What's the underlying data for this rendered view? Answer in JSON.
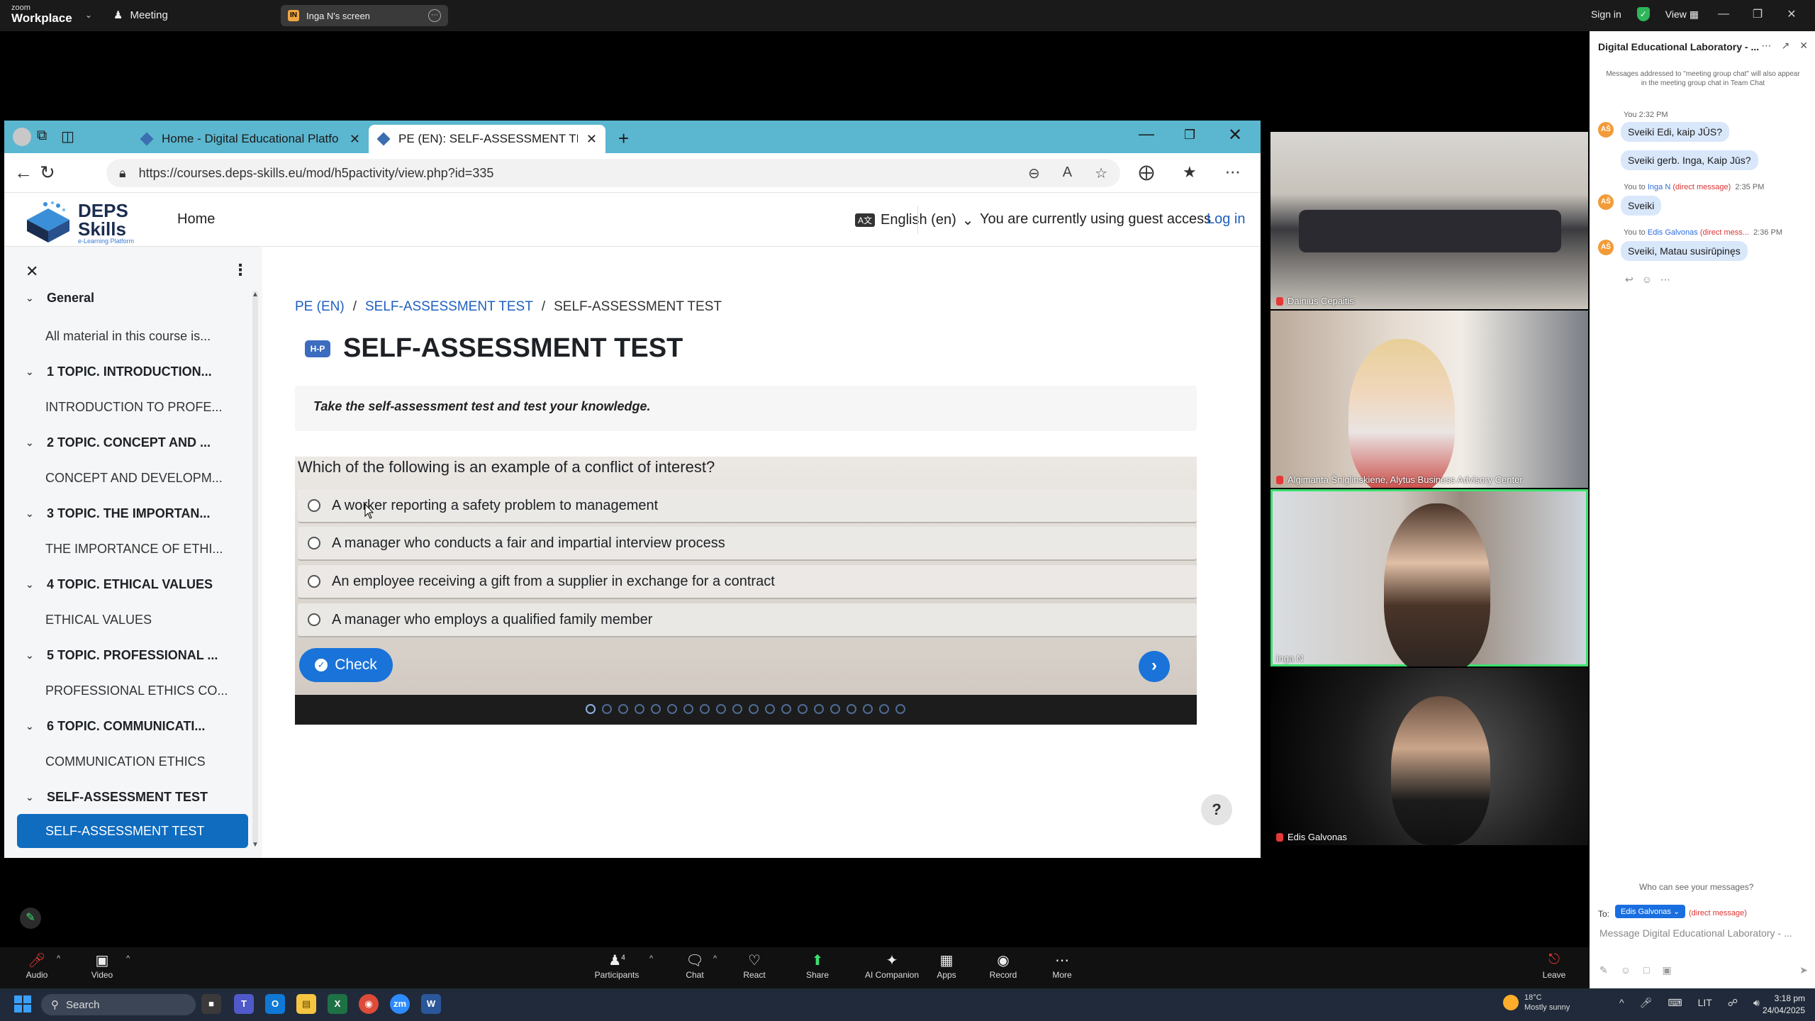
{
  "zoom": {
    "logo_small": "zoom",
    "logo_big": "Workplace",
    "meeting_label": "Meeting",
    "share_badge": "IN",
    "share_label": "Inga N's screen",
    "sign_in": "Sign in",
    "view": "View"
  },
  "browser": {
    "tabs": [
      {
        "label": "Home - Digital Educational Platfo"
      },
      {
        "label": "PE (EN): SELF-ASSESSMENT TEST"
      }
    ],
    "url": "https://courses.deps-skills.eu/mod/h5pactivity/view.php?id=335"
  },
  "site": {
    "logo_line1": "DEPS",
    "logo_line2": "Skills",
    "logo_tag": "e-Learning Platform",
    "nav_home": "Home",
    "language": "English (en)",
    "guest_notice": "You are currently using guest access",
    "login": "Log in"
  },
  "sidebar": {
    "sections": [
      {
        "title": "General",
        "item": "All material in this course is..."
      },
      {
        "title": "1 TOPIC. INTRODUCTION...",
        "item": "INTRODUCTION TO PROFE..."
      },
      {
        "title": "2 TOPIC. CONCEPT AND ...",
        "item": "CONCEPT AND DEVELOPM..."
      },
      {
        "title": "3 TOPIC. THE IMPORTAN...",
        "item": "THE IMPORTANCE OF ETHI..."
      },
      {
        "title": "4 TOPIC. ETHICAL VALUES",
        "item": "ETHICAL VALUES"
      },
      {
        "title": "5 TOPIC. PROFESSIONAL ...",
        "item": "PROFESSIONAL ETHICS CO..."
      },
      {
        "title": "6 TOPIC. COMMUNICATI...",
        "item": "COMMUNICATION ETHICS"
      },
      {
        "title": "SELF-ASSESSMENT TEST",
        "item": "SELF-ASSESSMENT TEST"
      }
    ]
  },
  "main": {
    "breadcrumb": [
      "PE (EN)",
      "SELF-ASSESSMENT TEST",
      "SELF-ASSESSMENT TEST"
    ],
    "h5p_badge": "H-P",
    "title": "SELF-ASSESSMENT TEST",
    "intro": "Take the self-assessment test and test your knowledge.",
    "question": "Which of the following is an example of a conflict of interest?",
    "answers": [
      "A worker reporting a safety problem to management",
      "A manager who conducts a fair and impartial interview process",
      "An employee receiving a gift from a supplier in exchange for a contract",
      "A manager who employs a qualified family member"
    ],
    "check_label": "Check",
    "help": "?"
  },
  "gallery": [
    {
      "name": "Dainius Cepaitis"
    },
    {
      "name": "Algimanta Šniglinskienė, Alytus Business Advisory Center"
    },
    {
      "name": "Inga N"
    },
    {
      "name": "Edis Galvonas"
    }
  ],
  "chat": {
    "title": "Digital Educational Laboratory - ...",
    "notice": "Messages addressed to \"meeting group chat\" will also appear in the meeting group chat in Team Chat",
    "avatar": "AŠ",
    "messages": [
      {
        "meta_you": "You",
        "time": "2:32 PM",
        "text": "Sveiki Edi, kaip JŪS?"
      },
      {
        "text": "Sveiki gerb. Inga, Kaip Jūs?"
      },
      {
        "meta_you": "You to",
        "to": "Inga N",
        "dm": "(direct message)",
        "time": "2:35 PM",
        "text": "Sveiki"
      },
      {
        "meta_you": "You to",
        "to": "Edis Galvonas",
        "dm": "(direct mess...",
        "time": "2:36 PM",
        "text": "Sveiki, Matau susirūpinęs"
      }
    ],
    "who_can_see": "Who can see your messages?",
    "to_label": "To:",
    "to_recipient": "Edis Galvonas",
    "to_dm": "(direct message)",
    "input_placeholder": "Message Digital Educational Laboratory - ..."
  },
  "toolbar": {
    "participants_count": "4",
    "items": [
      "Audio",
      "Video",
      "Participants",
      "Chat",
      "React",
      "Share",
      "AI Companion",
      "Apps",
      "Record",
      "More",
      "Leave"
    ]
  },
  "taskbar": {
    "search": "Search",
    "temperature": "18°C",
    "weather": "Mostly sunny",
    "lang": "LIT",
    "time": "3:18 pm",
    "date": "24/04/2025"
  },
  "colors": {
    "accent": "#0f6cbf",
    "h5p_blue": "#1a73d9",
    "browser_tabbar": "#5bb6cf",
    "active_speaker": "#3ce070"
  }
}
